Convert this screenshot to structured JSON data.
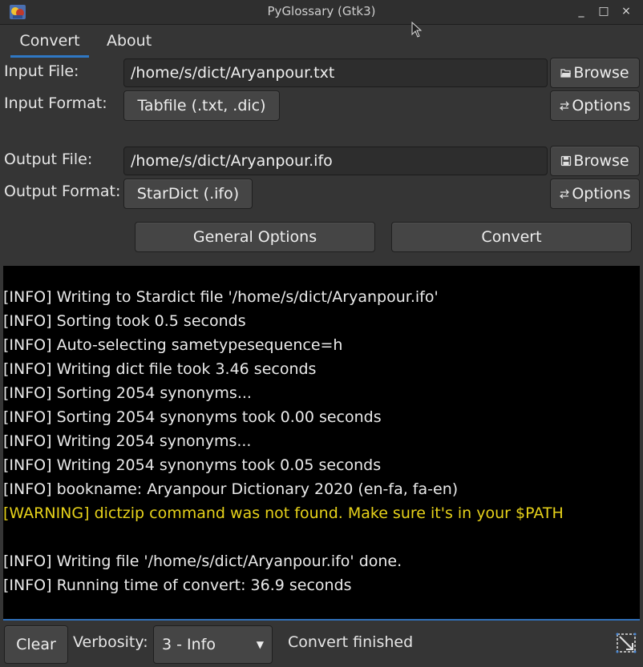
{
  "window": {
    "title": "PyGlossary (Gtk3)",
    "controls": {
      "minimize": "_",
      "maximize": "□",
      "close": "×"
    }
  },
  "tabs": [
    {
      "label": "Convert",
      "active": true
    },
    {
      "label": "About",
      "active": false
    }
  ],
  "convert": {
    "input_file_label": "Input File:",
    "input_file_value": "/home/s/dict/Aryanpour.txt",
    "input_browse": "Browse",
    "input_format_label": "Input Format:",
    "input_format_value": "Tabfile (.txt, .dic)",
    "input_options": "Options",
    "output_file_label": "Output File:",
    "output_file_value": "/home/s/dict/Aryanpour.ifo",
    "output_browse": "Browse",
    "output_format_label": "Output Format:",
    "output_format_value": "StarDict (.ifo)",
    "output_options": "Options",
    "general_options": "General Options",
    "convert_button": "Convert"
  },
  "log": [
    {
      "text": "[INFO] Writing to Stardict file '/home/s/dict/Aryanpour.ifo'",
      "level": "info"
    },
    {
      "text": "[INFO] Sorting took 0.5 seconds",
      "level": "info"
    },
    {
      "text": "[INFO] Auto-selecting sametypesequence=h",
      "level": "info"
    },
    {
      "text": "[INFO] Writing dict file took 3.46 seconds",
      "level": "info"
    },
    {
      "text": "[INFO] Sorting 2054 synonyms...",
      "level": "info"
    },
    {
      "text": "[INFO] Sorting 2054 synonyms took 0.00 seconds",
      "level": "info"
    },
    {
      "text": "[INFO] Writing 2054 synonyms...",
      "level": "info"
    },
    {
      "text": "[INFO] Writing 2054 synonyms took 0.05 seconds",
      "level": "info"
    },
    {
      "text": "[INFO] bookname: Aryanpour Dictionary 2020 (en-fa, fa-en)",
      "level": "info"
    },
    {
      "text": "[WARNING] dictzip command was not found. Make sure it's in your $PATH",
      "level": "warning"
    },
    {
      "text": "",
      "level": "info"
    },
    {
      "text": "[INFO] Writing file '/home/s/dict/Aryanpour.ifo' done.",
      "level": "info"
    },
    {
      "text": "[INFO] Running time of convert: 36.9 seconds",
      "level": "info"
    }
  ],
  "status": {
    "clear": "Clear",
    "verbosity_label": "Verbosity:",
    "verbosity_value": "3 - Info",
    "message": "Convert finished"
  },
  "colors": {
    "accent": "#2f78c4",
    "warning": "#e7d21a",
    "log_bg": "#000000"
  }
}
